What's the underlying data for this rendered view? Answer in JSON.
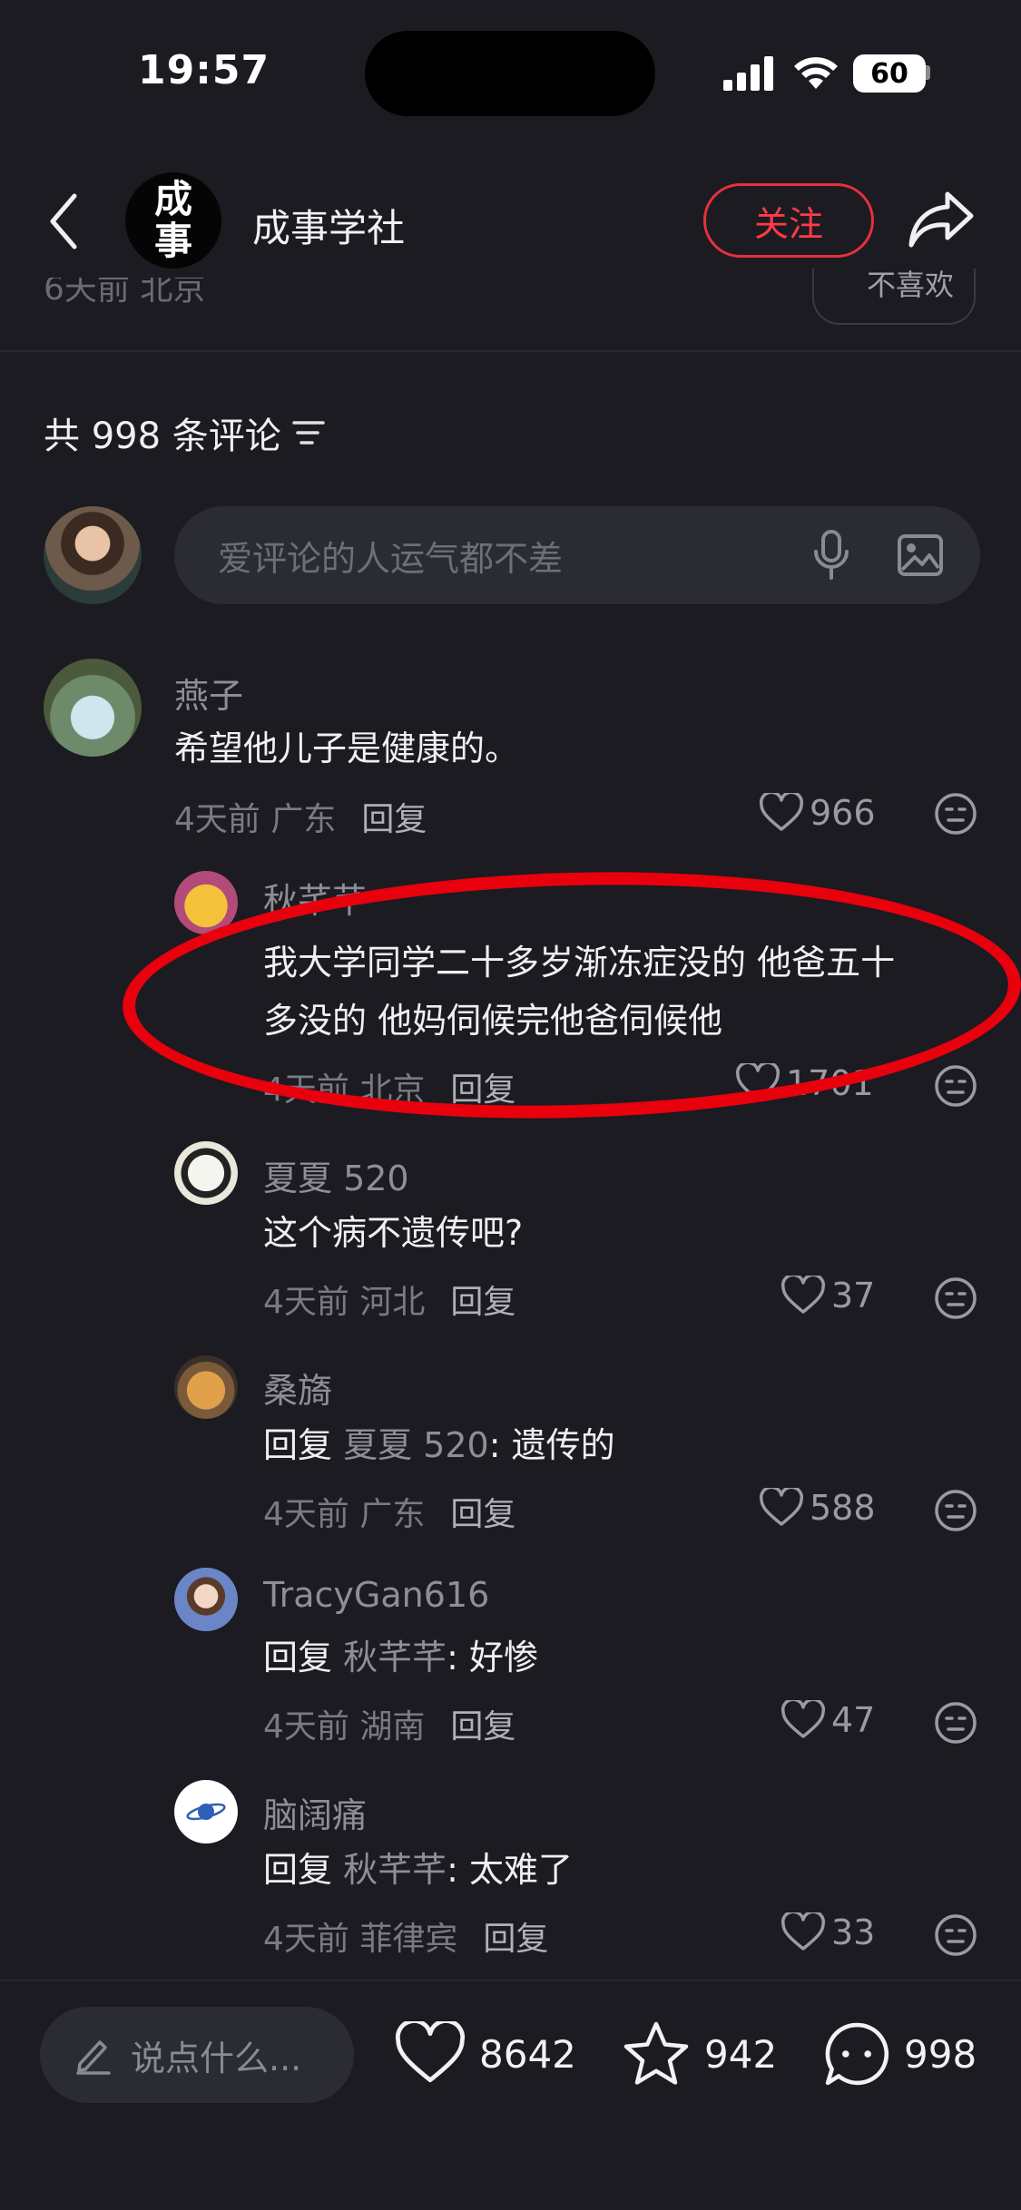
{
  "status_bar": {
    "time": "19:57",
    "battery": "60"
  },
  "header": {
    "author_name": "成事学社",
    "follow_label": "关注",
    "avatar_text": "成事"
  },
  "post": {
    "meta": "6天前 北京",
    "dislike": "不喜欢"
  },
  "comments_header": {
    "count_label": "共 998 条评论"
  },
  "input": {
    "placeholder": "爱评论的人运气都不差"
  },
  "comments": [
    {
      "name": "燕子",
      "text": "希望他儿子是健康的。",
      "meta": "4天前 广东",
      "reply": "回复",
      "likes": "966"
    },
    {
      "name": "秋芊芊",
      "text_line1": "我大学同学二十多岁渐冻症没的 他爸五十",
      "text_line2": "多没的 他妈伺候完他爸伺候他",
      "meta": "4天前 北京",
      "reply": "回复",
      "likes": "1701"
    },
    {
      "name": "夏夏 520",
      "text": "这个病不遗传吧?",
      "meta": "4天前 河北",
      "reply": "回复",
      "likes": "37"
    },
    {
      "name": "桑旖",
      "reply_prefix": "回复",
      "reply_to": "夏夏 520",
      "text": ": 遗传的",
      "meta": "4天前 广东",
      "reply": "回复",
      "likes": "588"
    },
    {
      "name": "TracyGan616",
      "reply_prefix": "回复",
      "reply_to": "秋芊芊",
      "text": ": 好惨",
      "meta": "4天前 湖南",
      "reply": "回复",
      "likes": "47"
    },
    {
      "name": "脑阔痛",
      "reply_prefix": "回复",
      "reply_to": "秋芊芊",
      "text": ": 太难了",
      "meta": "4天前 菲律宾",
      "reply": "回复",
      "likes": "33"
    }
  ],
  "bottom_bar": {
    "say_placeholder": "说点什么...",
    "likes": "8642",
    "stars": "942",
    "comments": "998"
  },
  "colors": {
    "background": "#1b1b21",
    "accent_red": "#e5313d",
    "annotation_red": "#e8000d"
  }
}
